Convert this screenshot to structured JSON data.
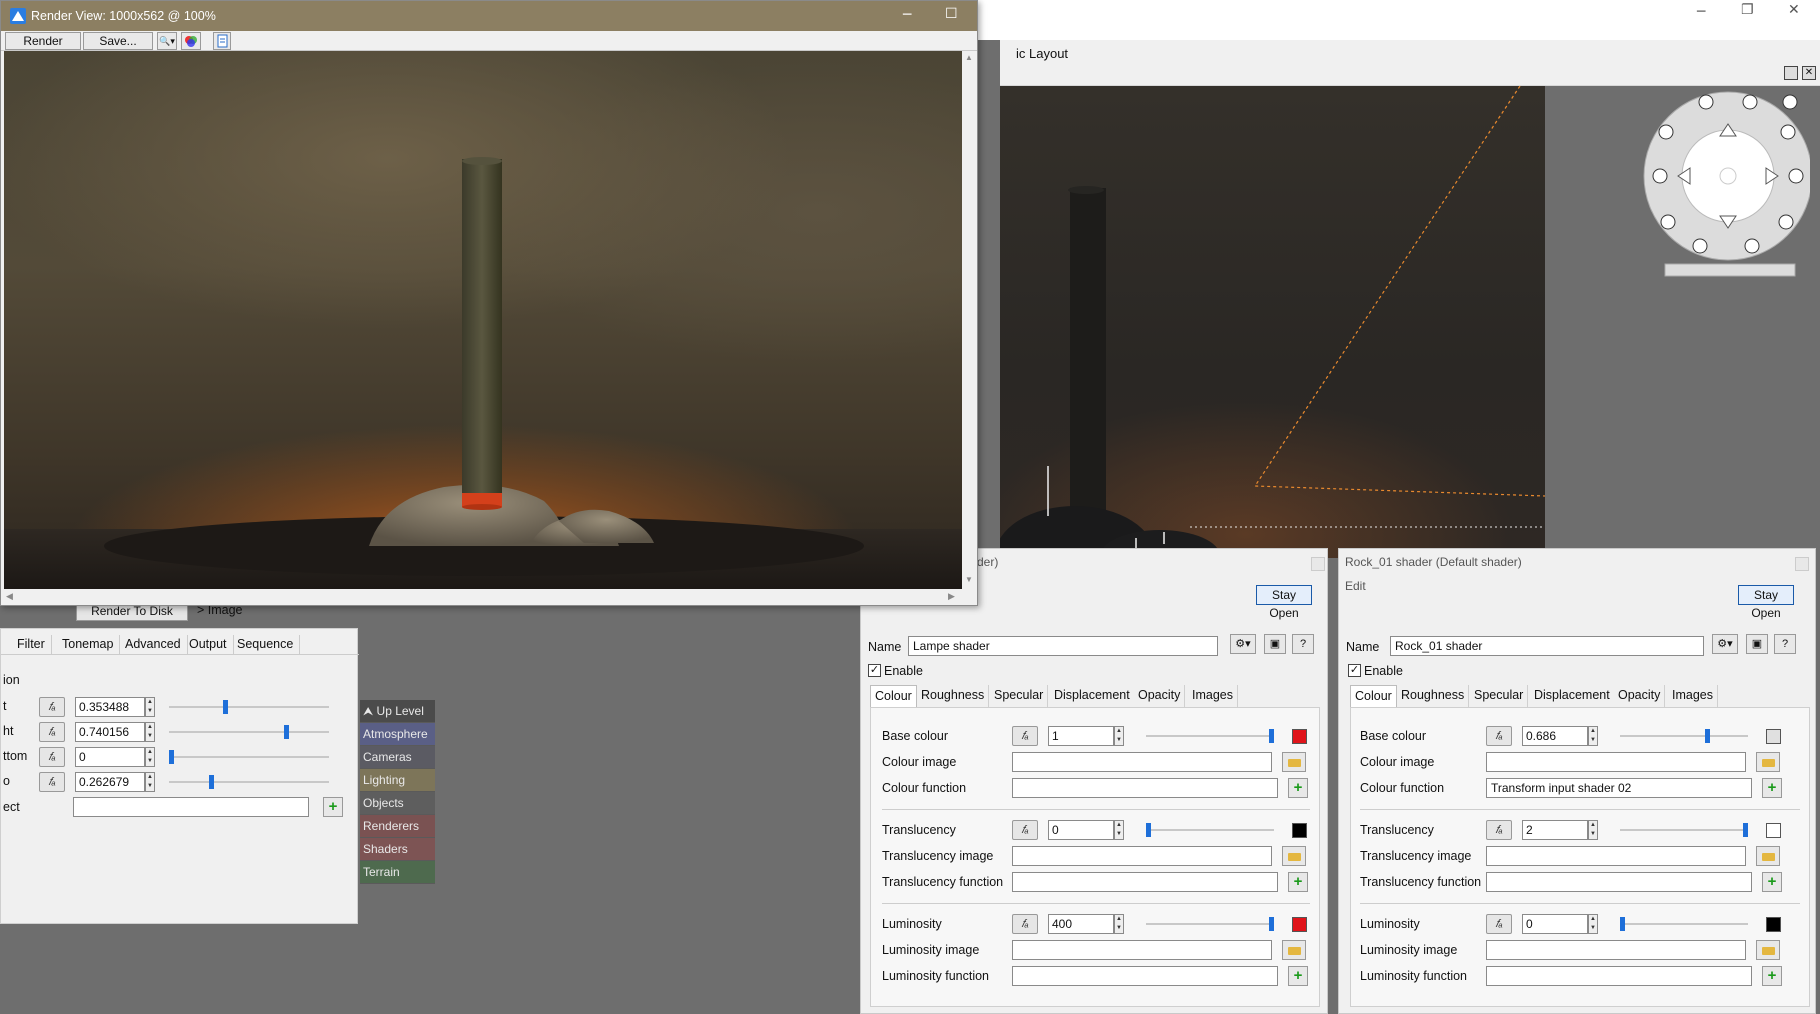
{
  "main_window": {
    "layout_label": "ic Layout",
    "controls": {
      "minimize": "─",
      "restore": "❐",
      "close": "✕"
    }
  },
  "render_view": {
    "title": "Render View: 1000x562 @ 100%",
    "toolbar": {
      "render": "Render",
      "save": "Save...",
      "zoom": "🔍▾"
    },
    "controls": {
      "minimize": "─",
      "maximize": "☐",
      "close": "✕"
    }
  },
  "render_settings": {
    "render_to_disk": "Render To Disk",
    "image_label": "> Image",
    "tabs": [
      "Filter",
      "Tonemap",
      "Advanced",
      "Output",
      "Sequence"
    ],
    "section_label": "ion",
    "rows": [
      {
        "label": "t",
        "value": "0.353488",
        "slider": 0.35
      },
      {
        "label": "ht",
        "value": "0.740156",
        "slider": 0.74
      },
      {
        "label": "ttom",
        "value": "0",
        "slider": 0.0
      },
      {
        "label": "o",
        "value": "0.262679",
        "slider": 0.26
      }
    ],
    "last_label": "ect"
  },
  "categories": [
    {
      "label": "⮝ Up Level",
      "color": "#4b4b4b"
    },
    {
      "label": "Atmosphere",
      "color": "#5a5f86"
    },
    {
      "label": "Cameras",
      "color": "#5b5b63"
    },
    {
      "label": "Lighting",
      "color": "#7d7559"
    },
    {
      "label": "Objects",
      "color": "#5e5e5e"
    },
    {
      "label": "Renderers",
      "color": "#7a5252"
    },
    {
      "label": "Shaders",
      "color": "#7d5454"
    },
    {
      "label": "Terrain",
      "color": "#4e6a4e"
    }
  ],
  "shader_left": {
    "title": "der)",
    "stay_open": "Stay Open",
    "name_label": "Name",
    "name_value": "Lampe shader",
    "enable_label": "Enable",
    "tabs": [
      "Colour",
      "Roughness",
      "Specular",
      "Displacement",
      "Opacity",
      "Images"
    ],
    "base_colour": {
      "label": "Base colour",
      "value": "1",
      "slider": 1.0,
      "swatch": "#e0141a"
    },
    "colour_image": {
      "label": "Colour image"
    },
    "colour_function": {
      "label": "Colour function",
      "value": ""
    },
    "translucency": {
      "label": "Translucency",
      "value": "0",
      "slider": 0.0,
      "swatch": "#000000"
    },
    "translucency_image": {
      "label": "Translucency image"
    },
    "translucency_function": {
      "label": "Translucency function",
      "value": ""
    },
    "luminosity": {
      "label": "Luminosity",
      "value": "400",
      "slider": 1.0,
      "swatch": "#e0141a"
    },
    "luminosity_image": {
      "label": "Luminosity image"
    },
    "luminosity_function": {
      "label": "Luminosity function",
      "value": ""
    }
  },
  "shader_right": {
    "title": "Rock_01 shader    (Default shader)",
    "edit_menu": "Edit",
    "stay_open": "Stay Open",
    "name_label": "Name",
    "name_value": "Rock_01 shader",
    "enable_label": "Enable",
    "tabs": [
      "Colour",
      "Roughness",
      "Specular",
      "Displacement",
      "Opacity",
      "Images"
    ],
    "base_colour": {
      "label": "Base colour",
      "value": "0.686",
      "slider": 0.69,
      "swatch": "#e0e0e0"
    },
    "colour_image": {
      "label": "Colour image"
    },
    "colour_function": {
      "label": "Colour function",
      "value": "Transform input shader 02"
    },
    "translucency": {
      "label": "Translucency",
      "value": "2",
      "slider": 1.0,
      "swatch": "#ffffff"
    },
    "translucency_image": {
      "label": "Translucency image"
    },
    "translucency_function": {
      "label": "Translucency function",
      "value": ""
    },
    "luminosity": {
      "label": "Luminosity",
      "value": "0",
      "slider": 0.0,
      "swatch": "#000000"
    },
    "luminosity_image": {
      "label": "Luminosity image"
    },
    "luminosity_function": {
      "label": "Luminosity function",
      "value": ""
    }
  }
}
